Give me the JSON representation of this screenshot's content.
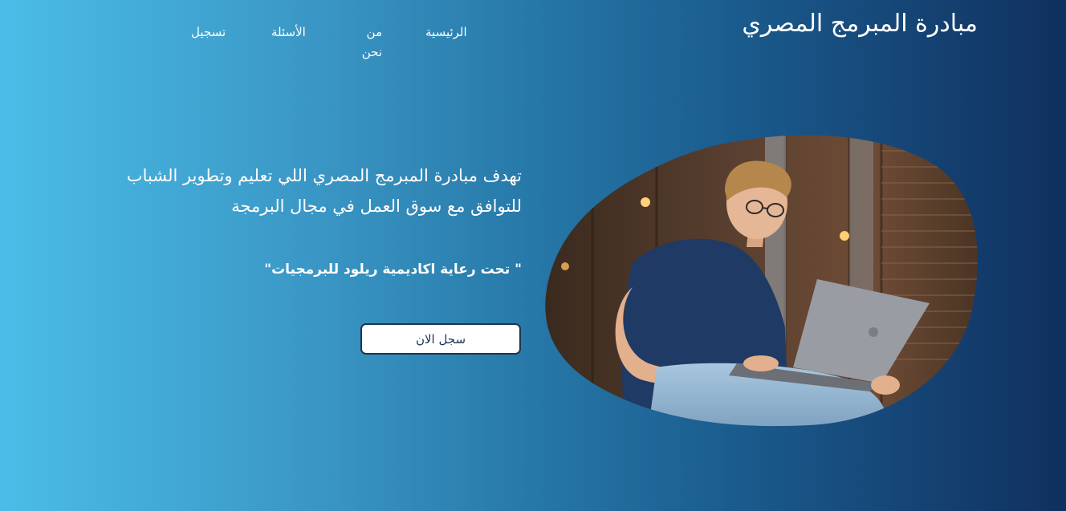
{
  "header": {
    "logo_text": "مبادرة المبرمج المصري",
    "nav": {
      "home": "الرئيسية",
      "about": "من نحن",
      "faq": "الأسئلة",
      "register": "تسجيل"
    }
  },
  "hero": {
    "description": "تهدف مبادرة المبرمج المصري اللي تعليم وتطوير الشباب للتوافق مع سوق العمل في مجال البرمجة",
    "sponsor": "\" تحت رعاية اكاديمية ريلود للبرمجيات\"",
    "cta_label": "سجل الان",
    "image_icon": "person-with-laptop-photo"
  },
  "colors": {
    "gradient_start": "#4bbde8",
    "gradient_end": "#10305f",
    "button_text": "#1b3552"
  }
}
